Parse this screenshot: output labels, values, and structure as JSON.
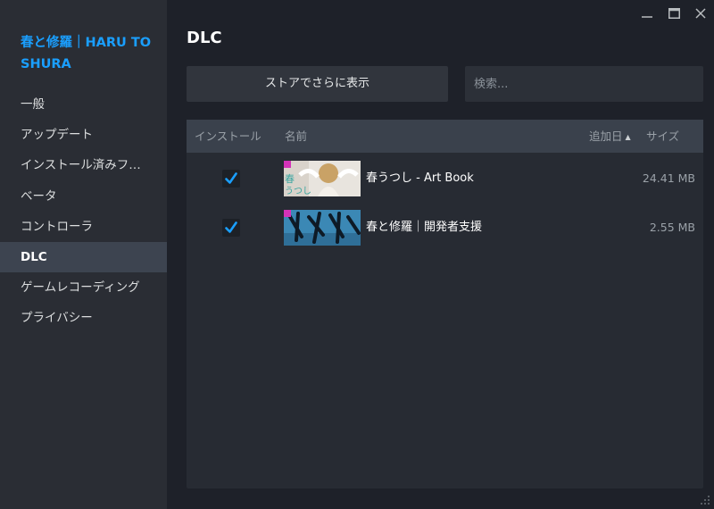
{
  "window": {
    "controls": [
      "minimize-icon",
      "maximize-icon",
      "close-icon"
    ]
  },
  "sidebar": {
    "game_title": "春と修羅｜HARU TO SHURA",
    "items": [
      {
        "label": "一般"
      },
      {
        "label": "アップデート"
      },
      {
        "label": "インストール済みファ..."
      },
      {
        "label": "ベータ"
      },
      {
        "label": "コントローラ"
      },
      {
        "label": "DLC",
        "active": true
      },
      {
        "label": "ゲームレコーディング"
      },
      {
        "label": "プライバシー"
      }
    ]
  },
  "main": {
    "title": "DLC",
    "store_button_label": "ストアでさらに表示",
    "search_placeholder": "検索..."
  },
  "table": {
    "columns": {
      "install": "インストール",
      "name": "名前",
      "date_added": "追加日",
      "size": "サイズ"
    },
    "sort": {
      "column": "date_added",
      "direction": "ascending"
    },
    "rows": [
      {
        "installed": true,
        "name": "春うつし - Art Book",
        "size": "24.41 MB"
      },
      {
        "installed": true,
        "name": "春と修羅｜開発者支援",
        "size": "2.55 MB"
      }
    ]
  },
  "colors": {
    "accent": "#1a9fff",
    "sidebar_bg": "#2a2d34",
    "main_bg": "#1e2129",
    "active_nav_bg": "#3d4450"
  }
}
